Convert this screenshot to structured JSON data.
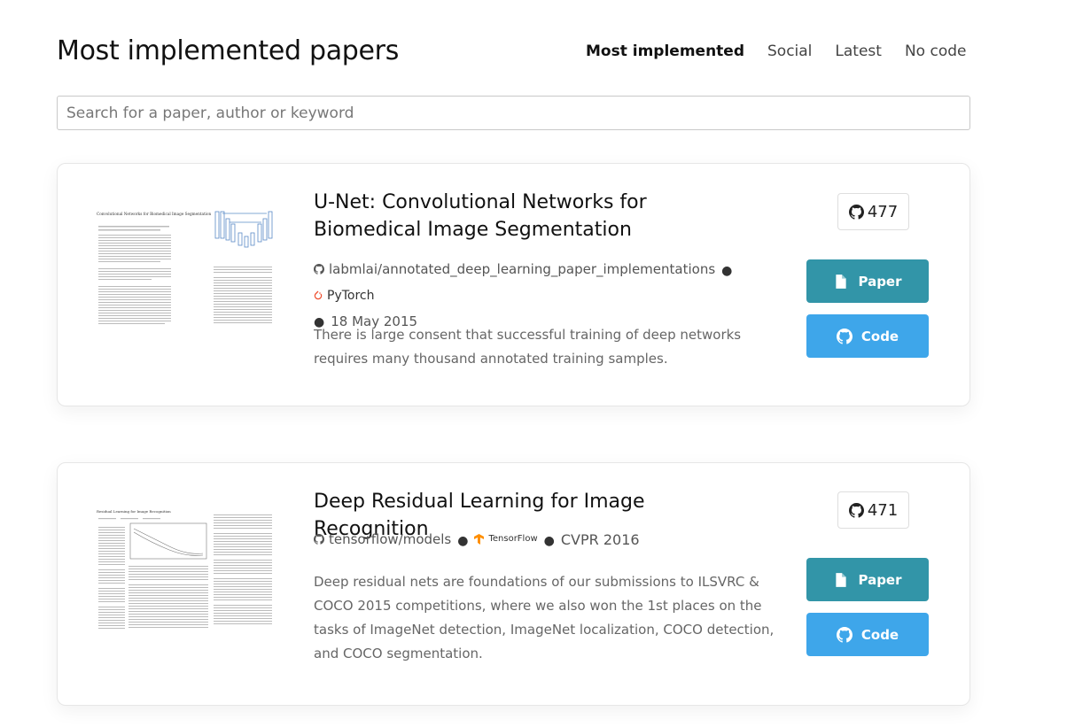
{
  "header": {
    "title": "Most implemented papers",
    "tabs": [
      {
        "label": "Most implemented",
        "active": true
      },
      {
        "label": "Social",
        "active": false
      },
      {
        "label": "Latest",
        "active": false
      },
      {
        "label": "No code",
        "active": false
      }
    ]
  },
  "search": {
    "placeholder": "Search for a paper, author or keyword",
    "value": ""
  },
  "papers": [
    {
      "title": "U-Net: Convolutional Networks for Biomedical Image Segmentation",
      "repo": "labmlai/annotated_deep_learning_paper_implementations",
      "framework": "PyTorch",
      "date": "18 May 2015",
      "abstract": "There is large consent that successful training of deep networks requires many thousand annotated training samples.",
      "stars": "477",
      "paper_label": "Paper",
      "code_label": "Code",
      "thumb_title": "Convolutional Networks for Biomedical Image Segmentation"
    },
    {
      "title": "Deep Residual Learning for Image Recognition",
      "repo": "tensorflow/models",
      "framework": "TensorFlow",
      "venue": "CVPR 2016",
      "abstract": "Deep residual nets are foundations of our submissions to ILSVRC & COCO 2015 competitions, where we also won the 1st places on the tasks of ImageNet detection, ImageNet localization, COCO detection, and COCO segmentation.",
      "stars": "471",
      "paper_label": "Paper",
      "code_label": "Code",
      "thumb_title": "Residual Learning for Image Recognition"
    }
  ],
  "colors": {
    "paper_button": "#3295a8",
    "code_button": "#3ea6ea",
    "pytorch": "#ee4c2c",
    "tensorflow": "#ff8f00"
  },
  "icons": {
    "github": "github-icon",
    "paper": "document-icon",
    "pytorch": "pytorch-icon",
    "tensorflow": "tensorflow-icon"
  }
}
